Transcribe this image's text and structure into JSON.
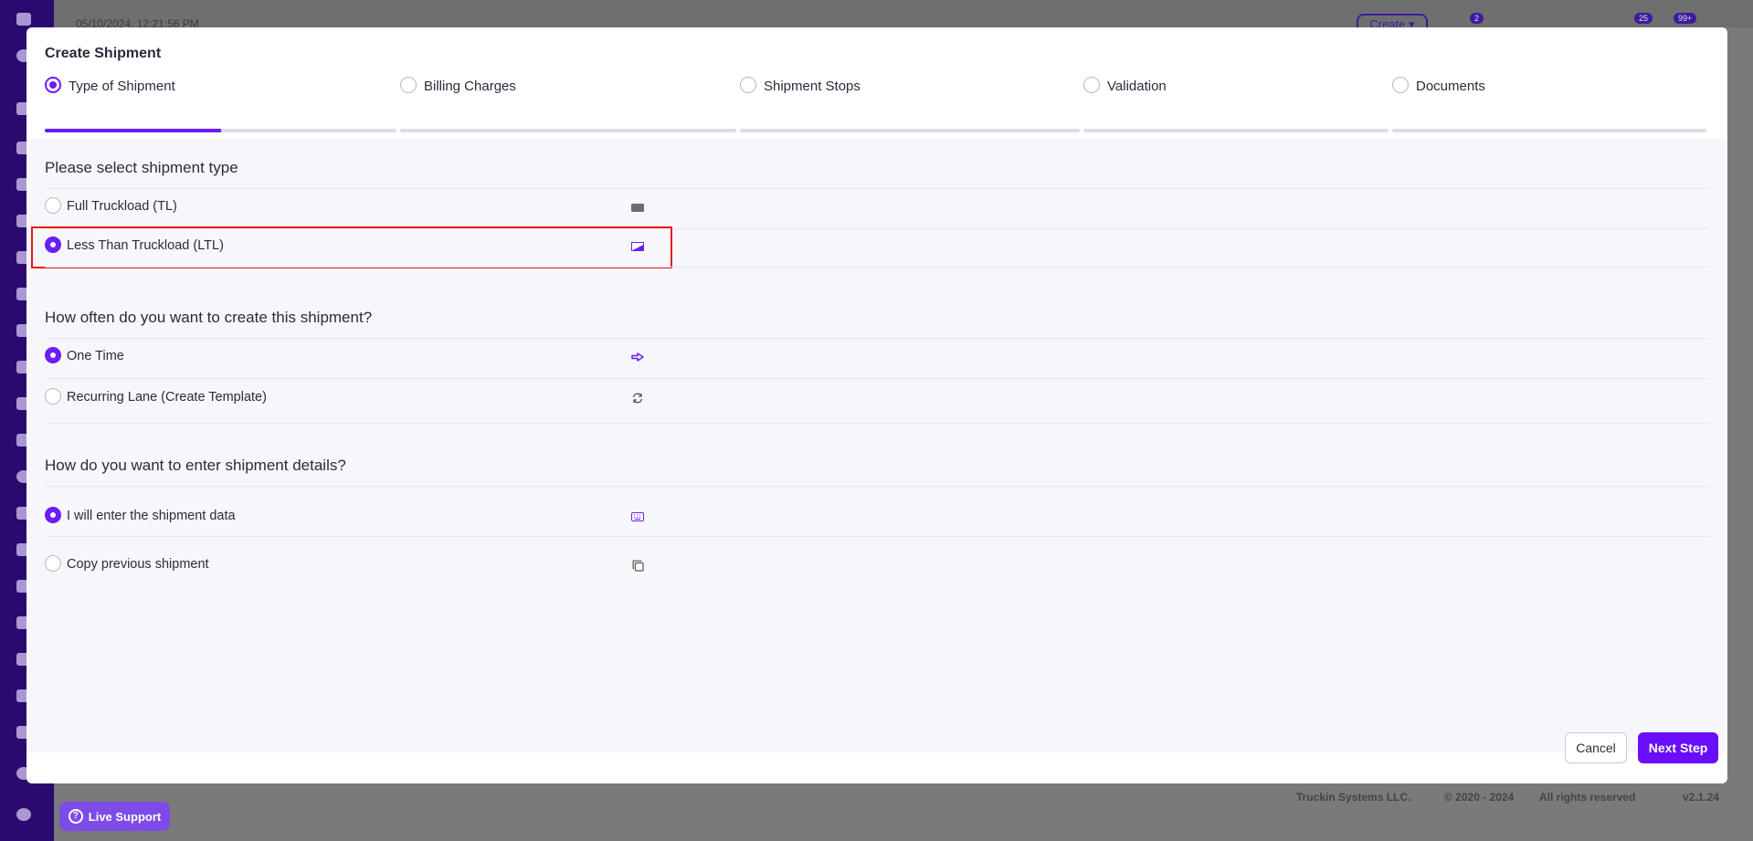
{
  "background": {
    "datetime": "05/10/2024, 12:21:56 PM",
    "create_label": "Create ▾",
    "badges": [
      "2",
      "25",
      "99+"
    ],
    "footer": {
      "company": "Truckin Systems LLC.",
      "copyright": "© 2020 - 2024",
      "rights": "All rights reserved",
      "version": "v2.1.24"
    },
    "live_support_label": "Live Support"
  },
  "modal": {
    "title": "Create Shipment",
    "steps": [
      {
        "label": "Type of Shipment",
        "state": "active",
        "progress": 0.5
      },
      {
        "label": "Billing Charges",
        "state": "pending",
        "progress": 0
      },
      {
        "label": "Shipment Stops",
        "state": "pending",
        "progress": 0
      },
      {
        "label": "Validation",
        "state": "pending",
        "progress": 0
      },
      {
        "label": "Documents",
        "state": "pending",
        "progress": 0
      }
    ],
    "sections": {
      "type": {
        "title": "Please select shipment type",
        "options": [
          {
            "label": "Full Truckload (TL)",
            "selected": false,
            "icon": "truck-icon"
          },
          {
            "label": "Less Than Truckload (LTL)",
            "selected": true,
            "icon": "partial-load-icon"
          }
        ]
      },
      "frequency": {
        "title": "How often do you want to create this shipment?",
        "options": [
          {
            "label": "One Time",
            "selected": true,
            "icon": "arrow-right-icon"
          },
          {
            "label": "Recurring Lane (Create Template)",
            "selected": false,
            "icon": "refresh-icon"
          }
        ]
      },
      "entry": {
        "title": "How do you want to enter shipment details?",
        "options": [
          {
            "label": "I will enter the shipment data",
            "selected": true,
            "icon": "keyboard-icon"
          },
          {
            "label": "Copy previous shipment",
            "selected": false,
            "icon": "copy-icon"
          }
        ]
      }
    },
    "buttons": {
      "cancel": "Cancel",
      "next": "Next Step"
    }
  },
  "colors": {
    "accent": "#6a1ef2",
    "highlight": "#e41b1b",
    "sidebar": "#2a0a6e"
  }
}
